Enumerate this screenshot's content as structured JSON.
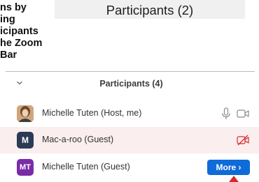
{
  "caption": {
    "lines": [
      "ns by",
      "ing",
      "icipants",
      "he Zoom",
      "Bar"
    ]
  },
  "banner": {
    "title": "Participants (2)"
  },
  "panel": {
    "title": "Participants (4)",
    "participants": [
      {
        "name": "Michelle Tuten (Host, me)",
        "avatar": "photo"
      },
      {
        "name": "Mac-a-roo (Guest)",
        "avatar": "M",
        "avatar_color": "#2b3a55"
      },
      {
        "name": "Michelle Tuten (Guest)",
        "avatar": "MT",
        "avatar_color": "#7a2ca8"
      }
    ],
    "more_button": "More ›"
  },
  "icons": {
    "collapse": "chevron-down-icon",
    "mic": "microphone-icon",
    "video": "video-camera-icon",
    "video_off": "video-off-icon"
  },
  "colors": {
    "accent": "#0e6bd8",
    "muted_red": "#d62b2b",
    "highlight_row": "#fbeeee"
  }
}
